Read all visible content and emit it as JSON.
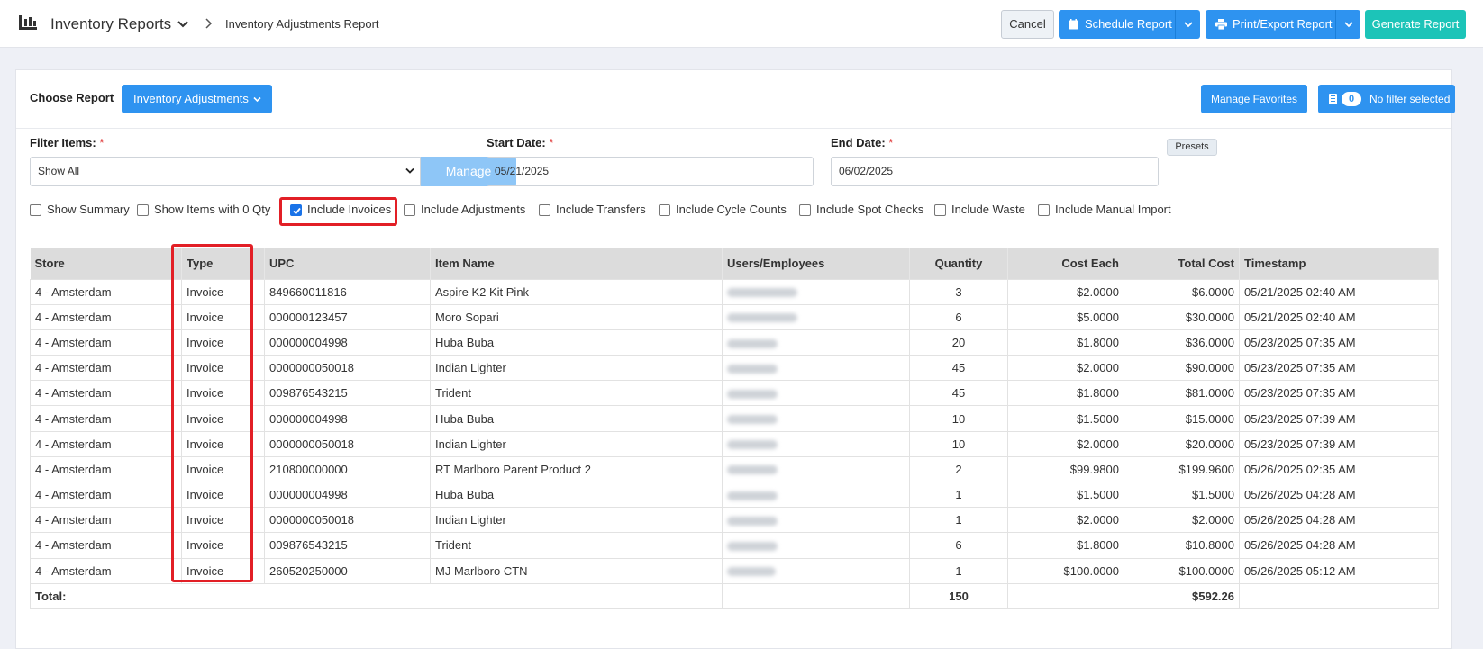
{
  "header": {
    "app_title": "Inventory Reports",
    "breadcrumb": "Inventory Adjustments Report",
    "cancel_label": "Cancel",
    "schedule_label": "Schedule Report",
    "print_label": "Print/Export Report",
    "generate_label": "Generate Report",
    "icons": [
      "report-icon",
      "chevron-down-icon",
      "chevron-right-icon",
      "calendar-icon",
      "printer-icon"
    ]
  },
  "report": {
    "choose_label": "Choose Report",
    "selected_report": "Inventory Adjustments",
    "manage_favorites_label": "Manage Favorites",
    "filter_count": "0",
    "filter_label": "No filter selected"
  },
  "filters": {
    "filter_items_label": "Filter Items:",
    "filter_items_value": "Show All",
    "manage_label": "Manage",
    "start_date_label": "Start Date:",
    "start_date_value": "05/21/2025",
    "end_date_label": "End Date:",
    "end_date_value": "06/02/2025",
    "presets_label": "Presets",
    "required_mark": "*"
  },
  "checkboxes": [
    {
      "label": "Show Summary",
      "checked": false
    },
    {
      "label": "Show Items with 0 Qty",
      "checked": false
    },
    {
      "label": "Include Invoices",
      "checked": true
    },
    {
      "label": "Include Adjustments",
      "checked": false
    },
    {
      "label": "Include Transfers",
      "checked": false
    },
    {
      "label": "Include Cycle Counts",
      "checked": false
    },
    {
      "label": "Include Spot Checks",
      "checked": false
    },
    {
      "label": "Include Waste",
      "checked": false
    },
    {
      "label": "Include Manual Import",
      "checked": false
    }
  ],
  "table": {
    "columns": [
      "Store",
      "Type",
      "UPC",
      "Item Name",
      "Users/Employees",
      "Quantity",
      "Cost Each",
      "Total Cost",
      "Timestamp"
    ],
    "rows": [
      {
        "store": "4 - Amsterdam",
        "type": "Invoice",
        "upc": "849660011816",
        "item": "Aspire K2 Kit Pink",
        "qty": "3",
        "cost_each": "$2.0000",
        "total": "$6.0000",
        "timestamp": "05/21/2025 02:40 AM"
      },
      {
        "store": "4 - Amsterdam",
        "type": "Invoice",
        "upc": "000000123457",
        "item": "Moro Sopari",
        "qty": "6",
        "cost_each": "$5.0000",
        "total": "$30.0000",
        "timestamp": "05/21/2025 02:40 AM"
      },
      {
        "store": "4 - Amsterdam",
        "type": "Invoice",
        "upc": "000000004998",
        "item": "Huba Buba",
        "qty": "20",
        "cost_each": "$1.8000",
        "total": "$36.0000",
        "timestamp": "05/23/2025 07:35 AM"
      },
      {
        "store": "4 - Amsterdam",
        "type": "Invoice",
        "upc": "0000000050018",
        "item": "Indian Lighter",
        "qty": "45",
        "cost_each": "$2.0000",
        "total": "$90.0000",
        "timestamp": "05/23/2025 07:35 AM"
      },
      {
        "store": "4 - Amsterdam",
        "type": "Invoice",
        "upc": "009876543215",
        "item": "Trident",
        "qty": "45",
        "cost_each": "$1.8000",
        "total": "$81.0000",
        "timestamp": "05/23/2025 07:35 AM"
      },
      {
        "store": "4 - Amsterdam",
        "type": "Invoice",
        "upc": "000000004998",
        "item": "Huba Buba",
        "qty": "10",
        "cost_each": "$1.5000",
        "total": "$15.0000",
        "timestamp": "05/23/2025 07:39 AM"
      },
      {
        "store": "4 - Amsterdam",
        "type": "Invoice",
        "upc": "0000000050018",
        "item": "Indian Lighter",
        "qty": "10",
        "cost_each": "$2.0000",
        "total": "$20.0000",
        "timestamp": "05/23/2025 07:39 AM"
      },
      {
        "store": "4 - Amsterdam",
        "type": "Invoice",
        "upc": "210800000000",
        "item": "RT Marlboro Parent Product 2",
        "qty": "2",
        "cost_each": "$99.9800",
        "total": "$199.9600",
        "timestamp": "05/26/2025 02:35 AM"
      },
      {
        "store": "4 - Amsterdam",
        "type": "Invoice",
        "upc": "000000004998",
        "item": "Huba Buba",
        "qty": "1",
        "cost_each": "$1.5000",
        "total": "$1.5000",
        "timestamp": "05/26/2025 04:28 AM"
      },
      {
        "store": "4 - Amsterdam",
        "type": "Invoice",
        "upc": "0000000050018",
        "item": "Indian Lighter",
        "qty": "1",
        "cost_each": "$2.0000",
        "total": "$2.0000",
        "timestamp": "05/26/2025 04:28 AM"
      },
      {
        "store": "4 - Amsterdam",
        "type": "Invoice",
        "upc": "009876543215",
        "item": "Trident",
        "qty": "6",
        "cost_each": "$1.8000",
        "total": "$10.8000",
        "timestamp": "05/26/2025 04:28 AM"
      },
      {
        "store": "4 - Amsterdam",
        "type": "Invoice",
        "upc": "260520250000",
        "item": "MJ Marlboro CTN",
        "qty": "1",
        "cost_each": "$100.0000",
        "total": "$100.0000",
        "timestamp": "05/26/2025 05:12 AM"
      }
    ],
    "total_label": "Total:",
    "total_qty": "150",
    "total_cost": "$592.26"
  },
  "colors": {
    "primary": "#2e93f0",
    "accent": "#1cc4b8",
    "highlight": "#e21f26"
  }
}
